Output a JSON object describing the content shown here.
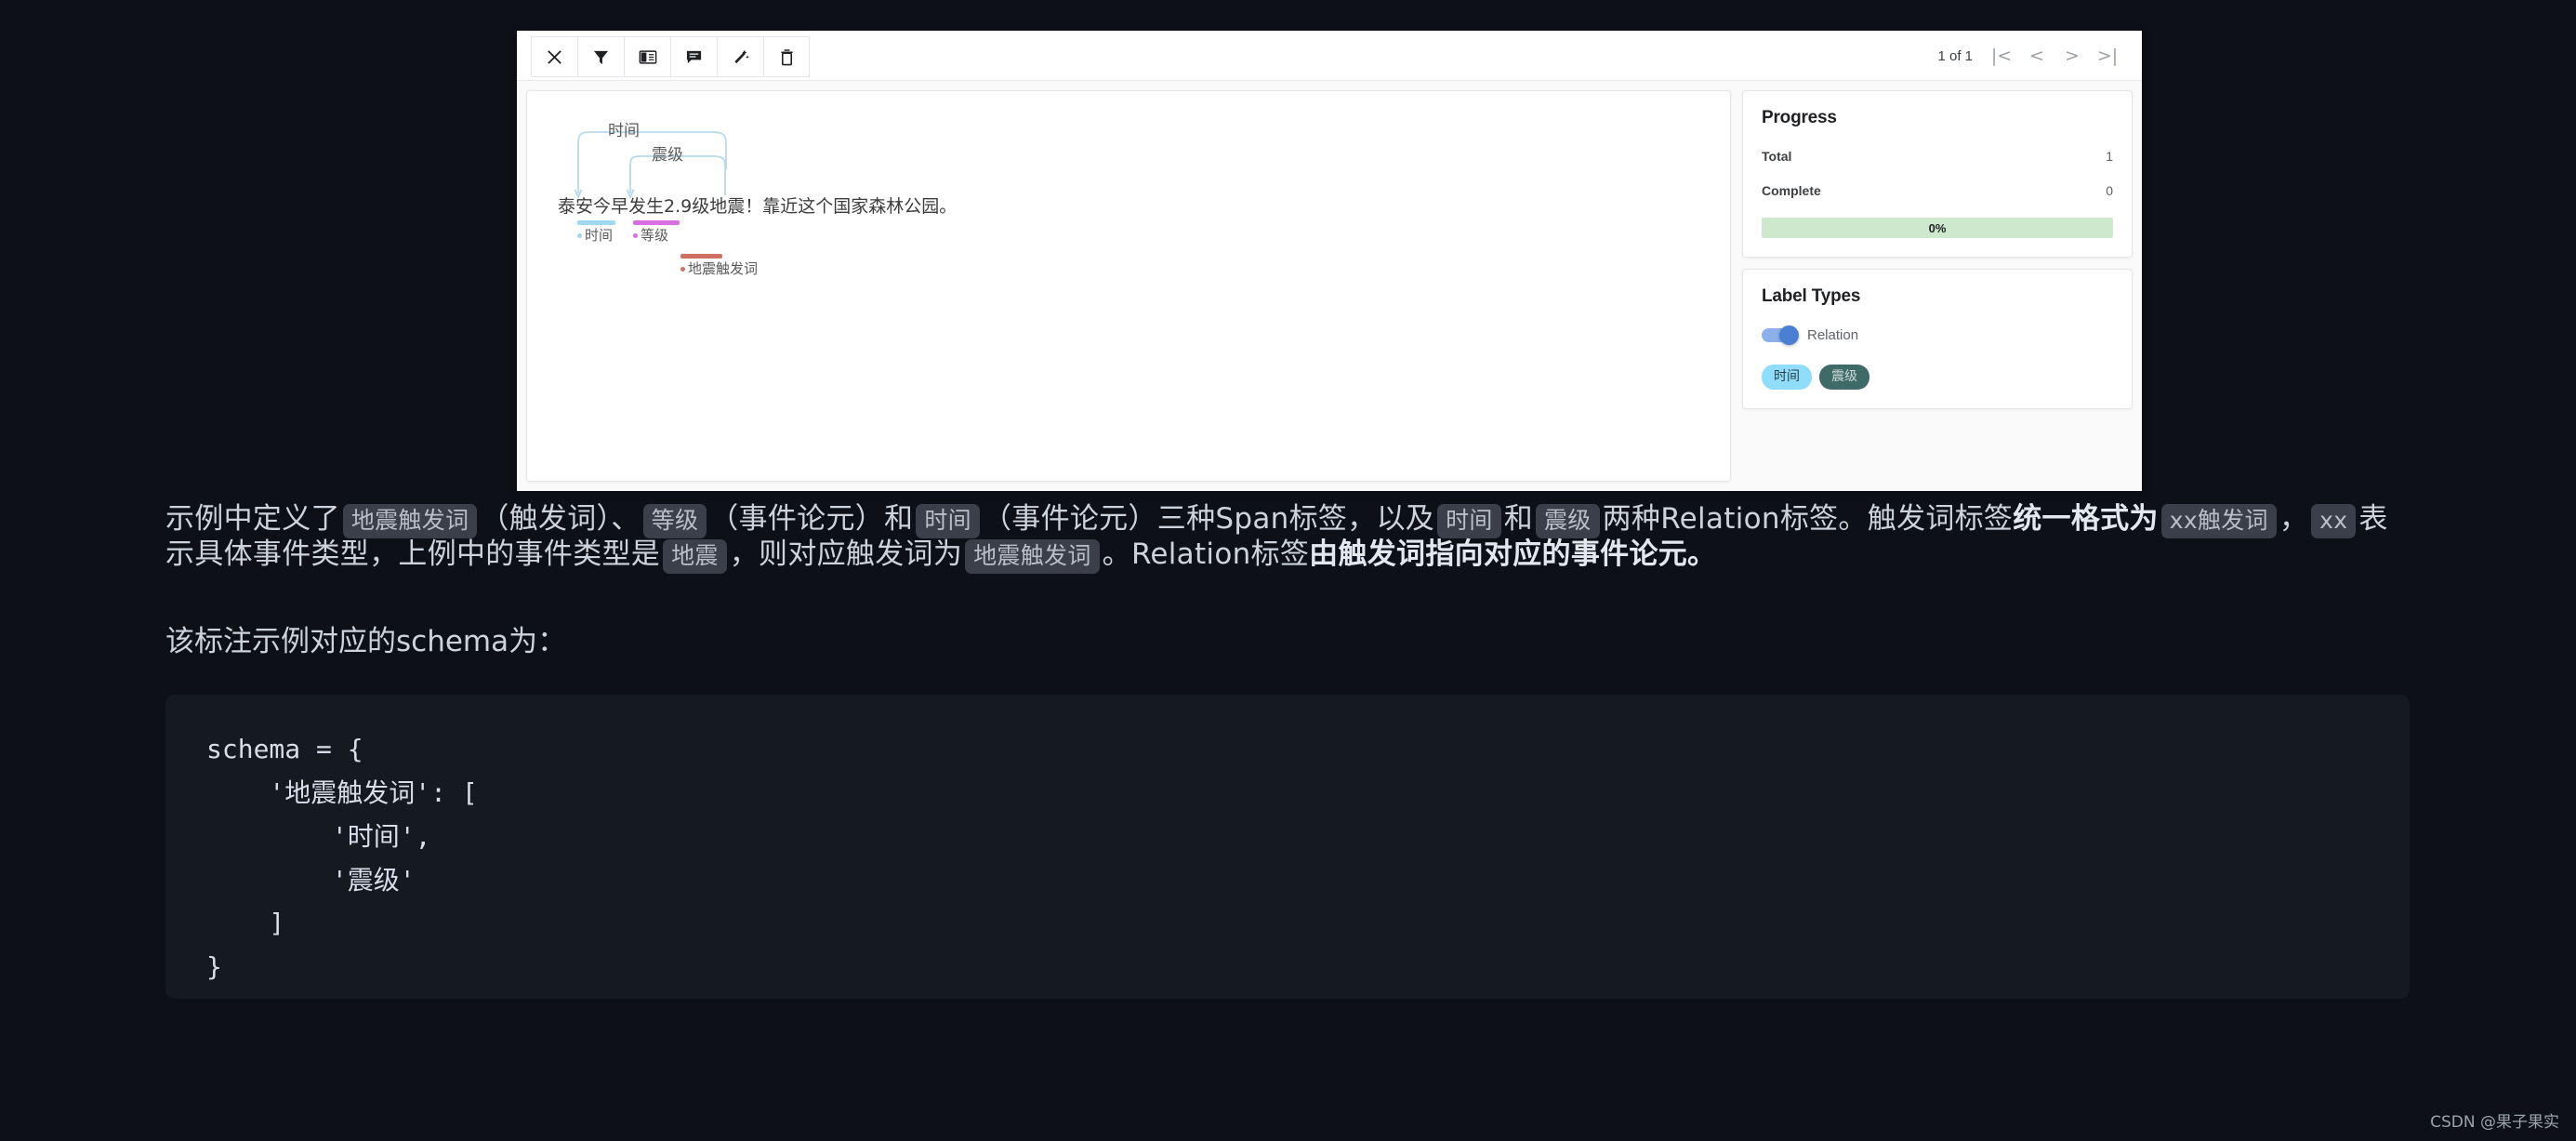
{
  "app": {
    "toolbar": {
      "buttons": [
        {
          "name": "close-icon",
          "label": "Close"
        },
        {
          "name": "filter-icon",
          "label": "Filter"
        },
        {
          "name": "layout-panel-icon",
          "label": "Layout"
        },
        {
          "name": "comment-icon",
          "label": "Comment"
        },
        {
          "name": "magic-wand-icon",
          "label": "Auto label"
        },
        {
          "name": "trash-icon",
          "label": "Delete"
        }
      ]
    },
    "pager": {
      "count_text": "1 of 1",
      "first_label": "|<",
      "prev_label": "<",
      "next_label": ">",
      "last_label": ">|"
    },
    "canvas": {
      "sentence": "泰安今早发生2.9级地震！靠近这个国家森林公园。",
      "relations": [
        {
          "label": "时间",
          "color": "#b8d9ec"
        },
        {
          "label": "震级",
          "color": "#b8d9ec"
        }
      ],
      "spans": [
        {
          "label": "时间",
          "color": "#9fd8f0",
          "text": "今早"
        },
        {
          "label": "等级",
          "color": "#d96fe0",
          "text": "2.9级"
        },
        {
          "label": "地震触发词",
          "color": "#cf7065",
          "text": "地震"
        }
      ]
    },
    "progress": {
      "title": "Progress",
      "total_label": "Total",
      "total_value": "1",
      "complete_label": "Complete",
      "complete_value": "0",
      "percent_text": "0%",
      "bar_color": "#cde8cd"
    },
    "label_types": {
      "title": "Label Types",
      "relation_toggle_label": "Relation",
      "relation_toggle_on": true,
      "toggle_color": "#4a7fd4",
      "chips": [
        {
          "label": "时间",
          "bg": "#8fdcfb",
          "fg": "#2c3b44"
        },
        {
          "label": "震级",
          "bg": "#3e6b68",
          "fg": "#cdd9d8"
        }
      ]
    }
  },
  "article": {
    "paragraph1": {
      "t1": "示例中定义了",
      "c1": "地震触发词",
      "t2": "（触发词）、",
      "c2": "等级",
      "t3": "（事件论元）和",
      "c3": "时间",
      "t4": "（事件论元）三种Span标签，以及",
      "c4": "时间",
      "t5": "和",
      "c5": "震级",
      "t6": "两种Relation标签。触发词标签",
      "b1": "统一格式为",
      "c6": "xx触发词",
      "t7": "，",
      "c7": "xx",
      "t8": "表示具体事件类型，上例中的事件类型是",
      "c8": "地震",
      "t9": "，则对应触发词为",
      "c9": "地震触发词",
      "t10": "。Relation标签",
      "b2": "由触发词指向对应的事件论元。"
    },
    "paragraph2": "该标注示例对应的schema为：",
    "code": "schema = {\n    '地震触发词': [\n        '时间',\n        '震级'\n    ]\n}"
  },
  "watermark": "CSDN @果子果实"
}
